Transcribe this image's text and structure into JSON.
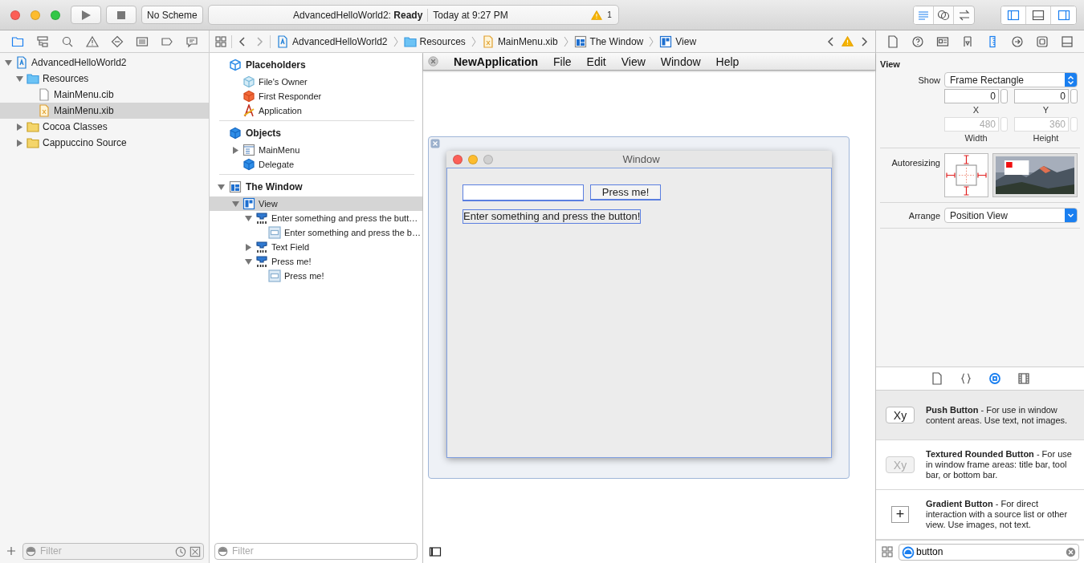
{
  "toolbar": {
    "scheme": "No Scheme",
    "activity": {
      "project": "AdvancedHelloWorld2:",
      "status": "Ready",
      "time": "Today at 9:27 PM",
      "warnings": "1"
    },
    "editor_modes": [
      {
        "selected": true
      },
      {
        "selected": false
      },
      {
        "selected": false
      }
    ],
    "panels": [
      {
        "on": true
      },
      {
        "on": false
      },
      {
        "on": true
      }
    ]
  },
  "navigator": {
    "tabs": [
      {
        "selected": true
      },
      {
        "selected": false
      },
      {
        "selected": false
      },
      {
        "selected": false
      },
      {
        "selected": false
      },
      {
        "selected": false
      },
      {
        "selected": false
      },
      {
        "selected": false
      }
    ],
    "tree": [
      {
        "label": "AdvancedHelloWorld2",
        "kind": "project",
        "expanded": true,
        "selected": false,
        "children": [
          {
            "label": "Resources",
            "kind": "group",
            "expanded": true,
            "selected": false,
            "children": [
              {
                "label": "MainMenu.cib",
                "kind": "file",
                "selected": false
              },
              {
                "label": "MainMenu.xib",
                "kind": "xib",
                "selected": true
              }
            ]
          },
          {
            "label": "Cocoa Classes",
            "kind": "folder",
            "expanded": false,
            "selected": false
          },
          {
            "label": "Cappuccino Source",
            "kind": "folder",
            "expanded": false,
            "selected": false
          }
        ]
      }
    ],
    "filter": {
      "placeholder": "Filter"
    }
  },
  "jump_bar": [
    {
      "label": "AdvancedHelloWorld2",
      "kind": "project"
    },
    {
      "label": "Resources",
      "kind": "group"
    },
    {
      "label": "MainMenu.xib",
      "kind": "xib"
    },
    {
      "label": "The Window",
      "kind": "window"
    },
    {
      "label": "View",
      "kind": "view"
    }
  ],
  "outline": {
    "sections": [
      {
        "title": "Placeholders",
        "kind": "placeholder",
        "items": [
          {
            "label": "File's Owner",
            "kind": "owner",
            "selected": false
          },
          {
            "label": "First Responder",
            "kind": "responder",
            "selected": false
          },
          {
            "label": "Application",
            "kind": "application",
            "selected": false
          }
        ]
      },
      {
        "title": "Objects",
        "kind": "object",
        "items": [
          {
            "label": "MainMenu",
            "kind": "menu",
            "expanded": false,
            "selected": false
          },
          {
            "label": "Delegate",
            "kind": "object",
            "selected": false
          }
        ]
      },
      {
        "title": "The Window",
        "kind": "window",
        "expanded": true,
        "items": [
          {
            "label": "View",
            "kind": "view",
            "expanded": true,
            "selected": true,
            "children": [
              {
                "label": "Enter something and press the butt…",
                "kind": "control",
                "expanded": true,
                "selected": false,
                "children": [
                  {
                    "label": "Enter something and press the b…",
                    "kind": "cell",
                    "selected": false
                  }
                ]
              },
              {
                "label": "Text Field",
                "kind": "control",
                "expanded": false,
                "selected": false
              },
              {
                "label": "Press me!",
                "kind": "control",
                "expanded": true,
                "selected": false,
                "children": [
                  {
                    "label": "Press me!",
                    "kind": "cell",
                    "selected": false
                  }
                ]
              }
            ]
          }
        ]
      }
    ],
    "filter": {
      "placeholder": "Filter"
    }
  },
  "canvas": {
    "menu_bar": {
      "app": "NewApplication",
      "items": [
        "File",
        "Edit",
        "View",
        "Window",
        "Help"
      ]
    },
    "window": {
      "title": "Window",
      "button": "Press me!",
      "label": "Enter something and press the button!"
    }
  },
  "inspector": {
    "tabs": [
      {
        "selected": false
      },
      {
        "selected": false
      },
      {
        "selected": false
      },
      {
        "selected": false
      },
      {
        "selected": true
      },
      {
        "selected": false
      },
      {
        "selected": false
      },
      {
        "selected": false
      }
    ],
    "title": "View",
    "show": {
      "label": "Show",
      "value": "Frame Rectangle"
    },
    "fields": [
      {
        "label": "X",
        "value": "0",
        "disabled": false
      },
      {
        "label": "Y",
        "value": "0",
        "disabled": false
      },
      {
        "label": "Width",
        "value": "480",
        "disabled": true
      },
      {
        "label": "Height",
        "value": "360",
        "disabled": true
      }
    ],
    "autoresizing": {
      "label": "Autoresizing"
    },
    "arrange": {
      "label": "Arrange",
      "value": "Position View"
    }
  },
  "library": {
    "tabs": [
      {
        "selected": false
      },
      {
        "selected": false
      },
      {
        "selected": true
      },
      {
        "selected": false
      }
    ],
    "items": [
      {
        "preview": "Xy",
        "kind": "push",
        "text": "**Push Button** - For use in window content areas. Use text, not images.",
        "selected": true
      },
      {
        "preview": "Xy",
        "kind": "textured",
        "text": "**Textured Rounded Button** - For use in window frame areas: title bar, tool bar, or bottom bar.",
        "selected": false
      },
      {
        "preview": "+",
        "kind": "gradient",
        "text": "**Gradient Button** - For direct interaction with a source list or other view. Use images, not text.",
        "selected": false
      }
    ],
    "search": {
      "value": "button"
    }
  }
}
